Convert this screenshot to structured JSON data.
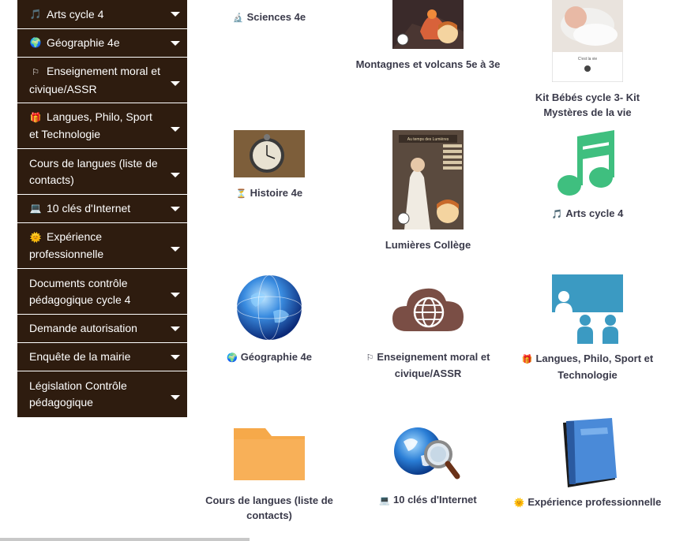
{
  "sidebar": {
    "items": [
      {
        "icon": "music-note-icon",
        "glyph": "🎵",
        "label": "Arts cycle 4"
      },
      {
        "icon": "globe-icon",
        "glyph": "🌍",
        "label": "Géographie 4e"
      },
      {
        "icon": "flag-icon",
        "glyph": "⚐",
        "label": "Enseignement moral et civique/ASSR"
      },
      {
        "icon": "gift-icon",
        "glyph": "🎁",
        "label": "Langues, Philo, Sport et Technologie"
      },
      {
        "icon": "",
        "glyph": "",
        "label": "Cours de langues (liste de contacts)"
      },
      {
        "icon": "laptop-icon",
        "glyph": "💻",
        "label": "10 clés d'Internet"
      },
      {
        "icon": "sun-icon",
        "glyph": "🌞",
        "label": "Expérience professionnelle"
      },
      {
        "icon": "",
        "glyph": "",
        "label": "Documents contrôle pédagogique cycle 4"
      },
      {
        "icon": "",
        "glyph": "",
        "label": "Demande autorisation"
      },
      {
        "icon": "",
        "glyph": "",
        "label": "Enquête de la mairie"
      },
      {
        "icon": "",
        "glyph": "",
        "label": "Législation Contrôle pédagogique"
      }
    ]
  },
  "tiles": [
    {
      "id": "sciences",
      "glyph": "🔬",
      "label": "Sciences 4e"
    },
    {
      "id": "volcans",
      "glyph": "",
      "label": "Montagnes et volcans 5e à 3e"
    },
    {
      "id": "bebes",
      "glyph": "",
      "label": "Kit Bébés cycle 3- Kit Mystères de la vie",
      "thumb_text": "C'est la vie"
    },
    {
      "id": "histoire",
      "glyph": "⏳",
      "label": "Histoire 4e"
    },
    {
      "id": "lumieres",
      "glyph": "",
      "label": "Lumières Collège",
      "thumb_text": "Au temps des Lumières"
    },
    {
      "id": "arts",
      "glyph": "🎵",
      "label": "Arts cycle 4"
    },
    {
      "id": "geo",
      "glyph": "🌍",
      "label": "Géographie 4e"
    },
    {
      "id": "emc",
      "glyph": "⚐",
      "label": "Enseignement moral et civique/ASSR"
    },
    {
      "id": "langues",
      "glyph": "🎁",
      "label": "Langues, Philo, Sport et Technologie"
    },
    {
      "id": "cours",
      "glyph": "",
      "label": "Cours de langues (liste de contacts)"
    },
    {
      "id": "internet",
      "glyph": "💻",
      "label": "10 clés d'Internet"
    },
    {
      "id": "experience",
      "glyph": "🌞",
      "label": "Expérience professionnelle"
    }
  ],
  "colors": {
    "sidebar_bg": "#2e1c0f",
    "label_text": "#3a3a4a",
    "music_green": "#3fbf7f",
    "classroom_blue": "#3b9ac2",
    "folder_orange": "#f6a94a",
    "cloud_brown": "#7a4e45"
  }
}
